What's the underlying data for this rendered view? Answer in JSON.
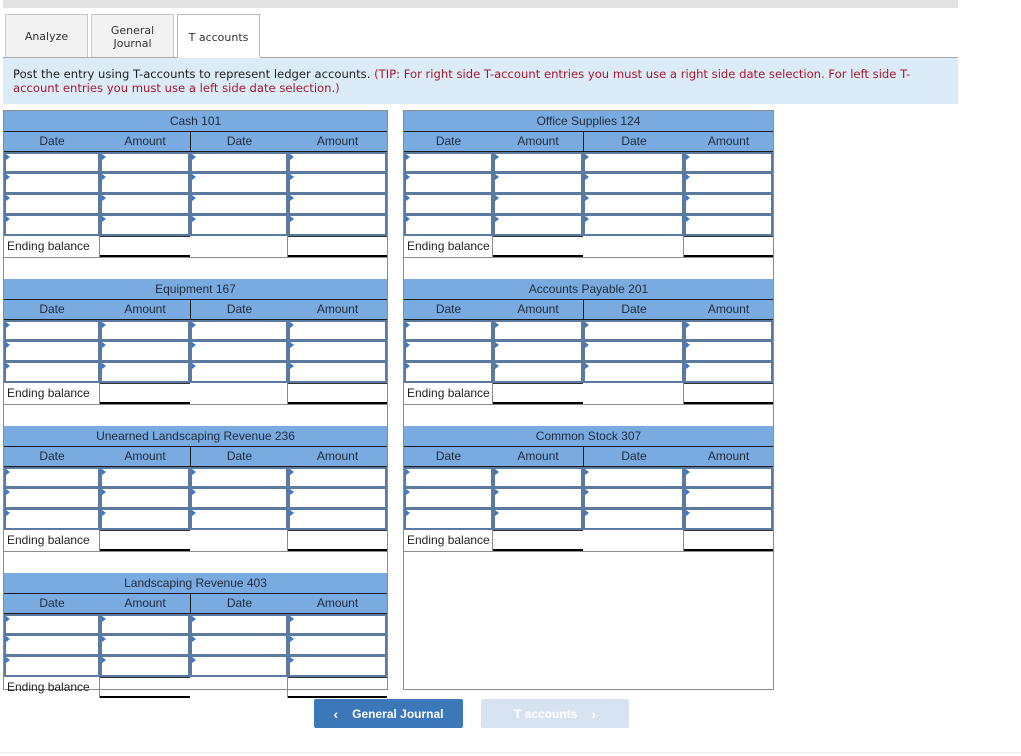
{
  "tabs": [
    {
      "label": "Analyze",
      "active": false
    },
    {
      "label": "General\nJournal",
      "label_line1": "General",
      "label_line2": "Journal",
      "active": false
    },
    {
      "label": "T accounts",
      "active": true
    }
  ],
  "instruction": {
    "text": "Post the entry using T-accounts to represent ledger accounts.",
    "tip": "(TIP: For right side T-account entries you must use a right side date selection. For left side T-account entries you must use a left side date selection.)"
  },
  "column_headers": {
    "date": "Date",
    "amount": "Amount"
  },
  "ending_balance_label": "Ending balance",
  "accounts": {
    "cash": {
      "title": "Cash 101",
      "rows": 4
    },
    "office_supplies": {
      "title": "Office Supplies 124",
      "rows": 4
    },
    "equipment": {
      "title": "Equipment 167",
      "rows": 3
    },
    "accounts_payable": {
      "title": "Accounts Payable 201",
      "rows": 3
    },
    "unearned_revenue": {
      "title": "Unearned Landscaping Revenue 236",
      "rows": 3
    },
    "common_stock": {
      "title": "Common Stock 307",
      "rows": 3
    },
    "landscaping_revenue": {
      "title": "Landscaping Revenue 403",
      "rows": 3
    }
  },
  "nav": {
    "prev_label": "General Journal",
    "next_label": "T accounts",
    "prev_icon": "chevron-left-icon",
    "next_icon": "chevron-right-icon",
    "next_enabled": false
  },
  "colors": {
    "header_blue": "#79abe1",
    "instruction_bg": "#dbecf8",
    "tip_text": "#a8182a",
    "primary_button": "#3c77b9",
    "disabled_button": "#d7e3f0"
  }
}
